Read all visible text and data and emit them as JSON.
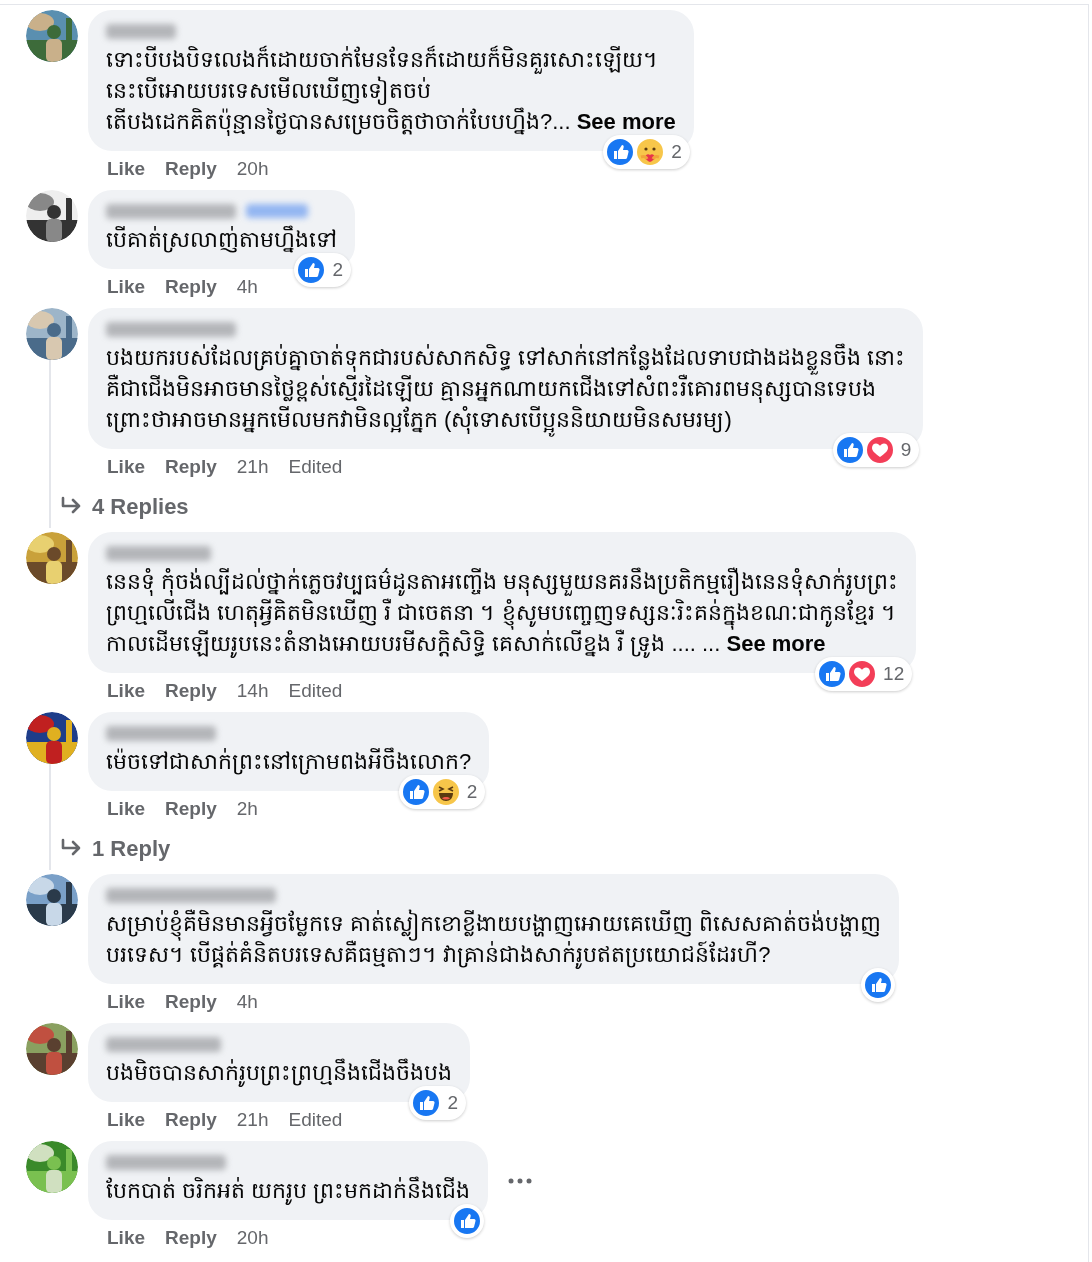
{
  "comments": [
    {
      "lines": [
        "ទោះបីបងបិទលេងក៏ដោយចាក់មែនទែនក៏ដោយក៏មិនគួរសោះឡើយ។",
        "នេះបើអោយបរទេសមើលឃើញទៀតចប់",
        "តើបងដេកគិតប៉ុន្មានថ្ងៃបានសម្រេចចិត្តថាចាក់បែបហ្នឹង?... "
      ],
      "see_more": "See more",
      "reactions": [
        {
          "kind": "like"
        },
        {
          "kind": "care"
        }
      ],
      "reaction_count": "2",
      "actions": {
        "like": "Like",
        "reply": "Reply",
        "time": "20h"
      }
    },
    {
      "lines": [
        "បើគាត់ស្រលាញ់តាមហ្នឹងទៅ"
      ],
      "reactions": [
        {
          "kind": "like"
        }
      ],
      "reaction_count": "2",
      "actions": {
        "like": "Like",
        "reply": "Reply",
        "time": "4h"
      }
    },
    {
      "lines": [
        "បងយករបស់ដែលគ្រប់គ្នាចាត់ទុកជារបស់សាកសិទ្ធ ទៅសាក់នៅកន្លែងដែលទាបជាងដងខ្លួនចឹង នោះ",
        "គឺជាជើងមិនអាចមានថ្លៃខ្ពស់ស្មើរដៃឡើយ គ្មានអ្នកណាយកជើងទៅសំពះរឺគោរពមនុស្សបានទេបង",
        "ព្រោះថាអាចមានអ្នកមើលមកវាមិនល្អភ្នែក (សុំទោសបើប្អូននិយាយមិនសមរម្យ)"
      ],
      "reactions": [
        {
          "kind": "like"
        },
        {
          "kind": "love"
        }
      ],
      "reaction_count": "9",
      "actions": {
        "like": "Like",
        "reply": "Reply",
        "time": "21h",
        "edited": "Edited"
      },
      "replies": "4 Replies"
    },
    {
      "lines": [
        "នេនទុំ កុំចង់ល្បីដល់ថ្នាក់ភ្លេចវប្បធម៌ដូនតាអញ្ចើង មនុស្សមួយនគរនឹងប្រតិកម្មរឿងនេនទុំសាក់រូបព្រះ",
        "ព្រហ្មលើជើង ហេតុអ្វីគិតមិនឃើញ រឺ ជាចេតនា ។ ខ្ញុំសូមបញ្ចេញទស្សនៈរិះគន់ក្នុងខណៈជាកូនខ្មែរ ។",
        "កាលដើមឡើយរូបនេះតំនាងអោយបរមីសក្ដិសិទ្ធិ គេសាក់លើខ្នង រឺ ទ្រូង .... ... "
      ],
      "see_more": "See more",
      "reactions": [
        {
          "kind": "like"
        },
        {
          "kind": "love"
        }
      ],
      "reaction_count": "12",
      "actions": {
        "like": "Like",
        "reply": "Reply",
        "time": "14h",
        "edited": "Edited"
      }
    },
    {
      "lines": [
        "ម៉េចទៅជាសាក់ព្រះនៅក្រោមពងអីចឹងលោក?"
      ],
      "reactions": [
        {
          "kind": "like"
        },
        {
          "kind": "haha"
        }
      ],
      "reaction_count": "2",
      "actions": {
        "like": "Like",
        "reply": "Reply",
        "time": "2h"
      },
      "replies": "1 Reply"
    },
    {
      "lines": [
        "សម្រាប់ខ្ញុំគឺមិនមានអ្វីចម្លែកទេ គាត់ស្លៀកខោខ្លីងាយបង្ហាញអោយគេឃើញ ពិសេសគាត់ចង់បង្ហាញ",
        "បរទេស។ បើផ្គត់គំនិតបរទេសគឺធម្មតាៗ។ វាគ្រាន់ជាងសាក់រូបឥតប្រយោជន៍ដែរហី?"
      ],
      "reactions": [
        {
          "kind": "like"
        }
      ],
      "actions": {
        "like": "Like",
        "reply": "Reply",
        "time": "4h"
      }
    },
    {
      "lines": [
        "បងមិចបានសាក់រូបព្រះព្រហ្មនឹងជើងចឹងបង"
      ],
      "reactions": [
        {
          "kind": "like"
        }
      ],
      "reaction_count": "2",
      "actions": {
        "like": "Like",
        "reply": "Reply",
        "time": "21h",
        "edited": "Edited"
      }
    },
    {
      "lines": [
        "បែកបាត់ ចរិកអត់ យករូប ព្រះមកដាក់នឹងជើង"
      ],
      "reactions": [
        {
          "kind": "like"
        }
      ],
      "actions": {
        "like": "Like",
        "reply": "Reply",
        "time": "20h"
      },
      "menu": true
    }
  ]
}
